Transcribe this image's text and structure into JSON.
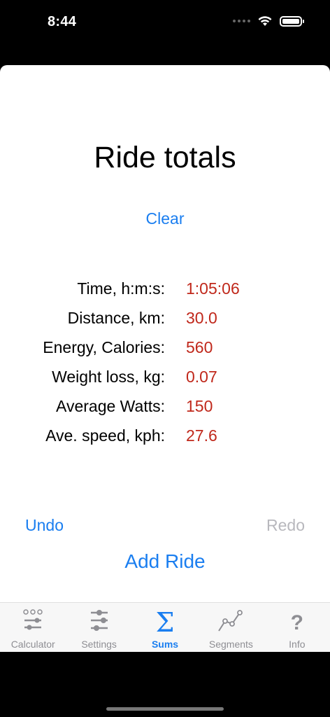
{
  "status_bar": {
    "time": "8:44"
  },
  "screen": {
    "title": "Ride totals",
    "clear_label": "Clear",
    "totals": [
      {
        "label": "Time, h:m:s:",
        "value": "1:05:06"
      },
      {
        "label": "Distance, km:",
        "value": "30.0"
      },
      {
        "label": "Energy, Calories:",
        "value": "560"
      },
      {
        "label": "Weight loss, kg:",
        "value": "0.07"
      },
      {
        "label": "Average Watts:",
        "value": "150"
      },
      {
        "label": "Ave. speed, kph:",
        "value": "27.6"
      }
    ],
    "undo_label": "Undo",
    "redo_label": "Redo",
    "add_ride_label": "Add Ride"
  },
  "tab_bar": {
    "tabs": [
      {
        "label": "Calculator",
        "icon": "calculator-sliders-icon",
        "active": false
      },
      {
        "label": "Settings",
        "icon": "settings-sliders-icon",
        "active": false
      },
      {
        "label": "Sums",
        "icon": "sigma-icon",
        "active": true
      },
      {
        "label": "Segments",
        "icon": "segments-graph-icon",
        "active": false
      },
      {
        "label": "Info",
        "icon": "question-mark-icon",
        "active": false
      }
    ]
  },
  "colors": {
    "accent": "#1a7ef0",
    "value_red": "#c0281b",
    "disabled_gray": "#b8b8bd",
    "tab_inactive": "#8e8e93"
  }
}
